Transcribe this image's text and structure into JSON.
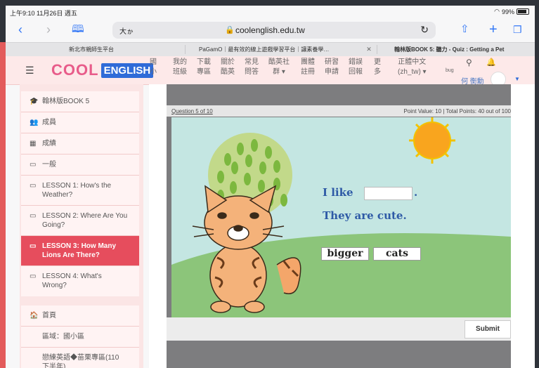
{
  "status": {
    "time": "上午9:10  11月26日 週五",
    "battery": "99%"
  },
  "browser": {
    "aa": "大ゕ",
    "url": "coolenglish.edu.tw",
    "tabs": [
      {
        "label": "新北市親師生平台"
      },
      {
        "label": "PaGamO｜最有效的線上遊戲學習平台｜讓素養學…"
      },
      {
        "label": "翰林版BOOK 5: 聽力 - Quiz : Getting a Pet"
      }
    ]
  },
  "site": {
    "logo_cool": "COOL",
    "logo_english": "ENGLISH",
    "nav": [
      {
        "label": "國\n小"
      },
      {
        "label": "我的\n班級"
      },
      {
        "label": "下載\n專區"
      },
      {
        "label": "關於\n酷英"
      },
      {
        "label": "常見\n問答"
      },
      {
        "label": "酷英社\n群 ▾"
      },
      {
        "label": "團體\n註冊"
      },
      {
        "label": "研習\n申請"
      },
      {
        "label": "錯誤\n回報"
      },
      {
        "label": "更\n多"
      },
      {
        "label": "正體中文\n(zh_tw) ▾"
      },
      {
        "label": "bug"
      }
    ],
    "user": "何 衡勳"
  },
  "sidebar": {
    "top": [
      {
        "icon": "🎓",
        "label": "翰林版BOOK 5"
      },
      {
        "icon": "👥",
        "label": "成員"
      },
      {
        "icon": "▦",
        "label": "成績"
      },
      {
        "icon": "▭",
        "label": "一般"
      },
      {
        "icon": "▭",
        "label": "LESSON 1: How's the\nWeather?"
      },
      {
        "icon": "▭",
        "label": "LESSON 2: Where Are You\nGoing?"
      },
      {
        "icon": "▭",
        "label": "LESSON 3: How Many\nLions Are There?"
      },
      {
        "icon": "▭",
        "label": "LESSON 4: What's\nWrong?"
      }
    ],
    "bottom": [
      {
        "icon": "🏠",
        "label": "首頁"
      },
      {
        "icon": "",
        "label": "區域：國小區"
      },
      {
        "icon": "",
        "label": "戀練英語◆苗栗專區(110\n下半年)"
      }
    ]
  },
  "quiz": {
    "question": "Question 5 of 10",
    "points": "Point Value: 10  |  Total Points: 40 out of 100",
    "line1": "I like",
    "line1_end": ".",
    "line2": "They are cute.",
    "choices": [
      "bigger",
      "cats"
    ],
    "submit": "Submit"
  },
  "colors": {
    "accent": "#e64d5d",
    "link": "#2f6bd8"
  }
}
